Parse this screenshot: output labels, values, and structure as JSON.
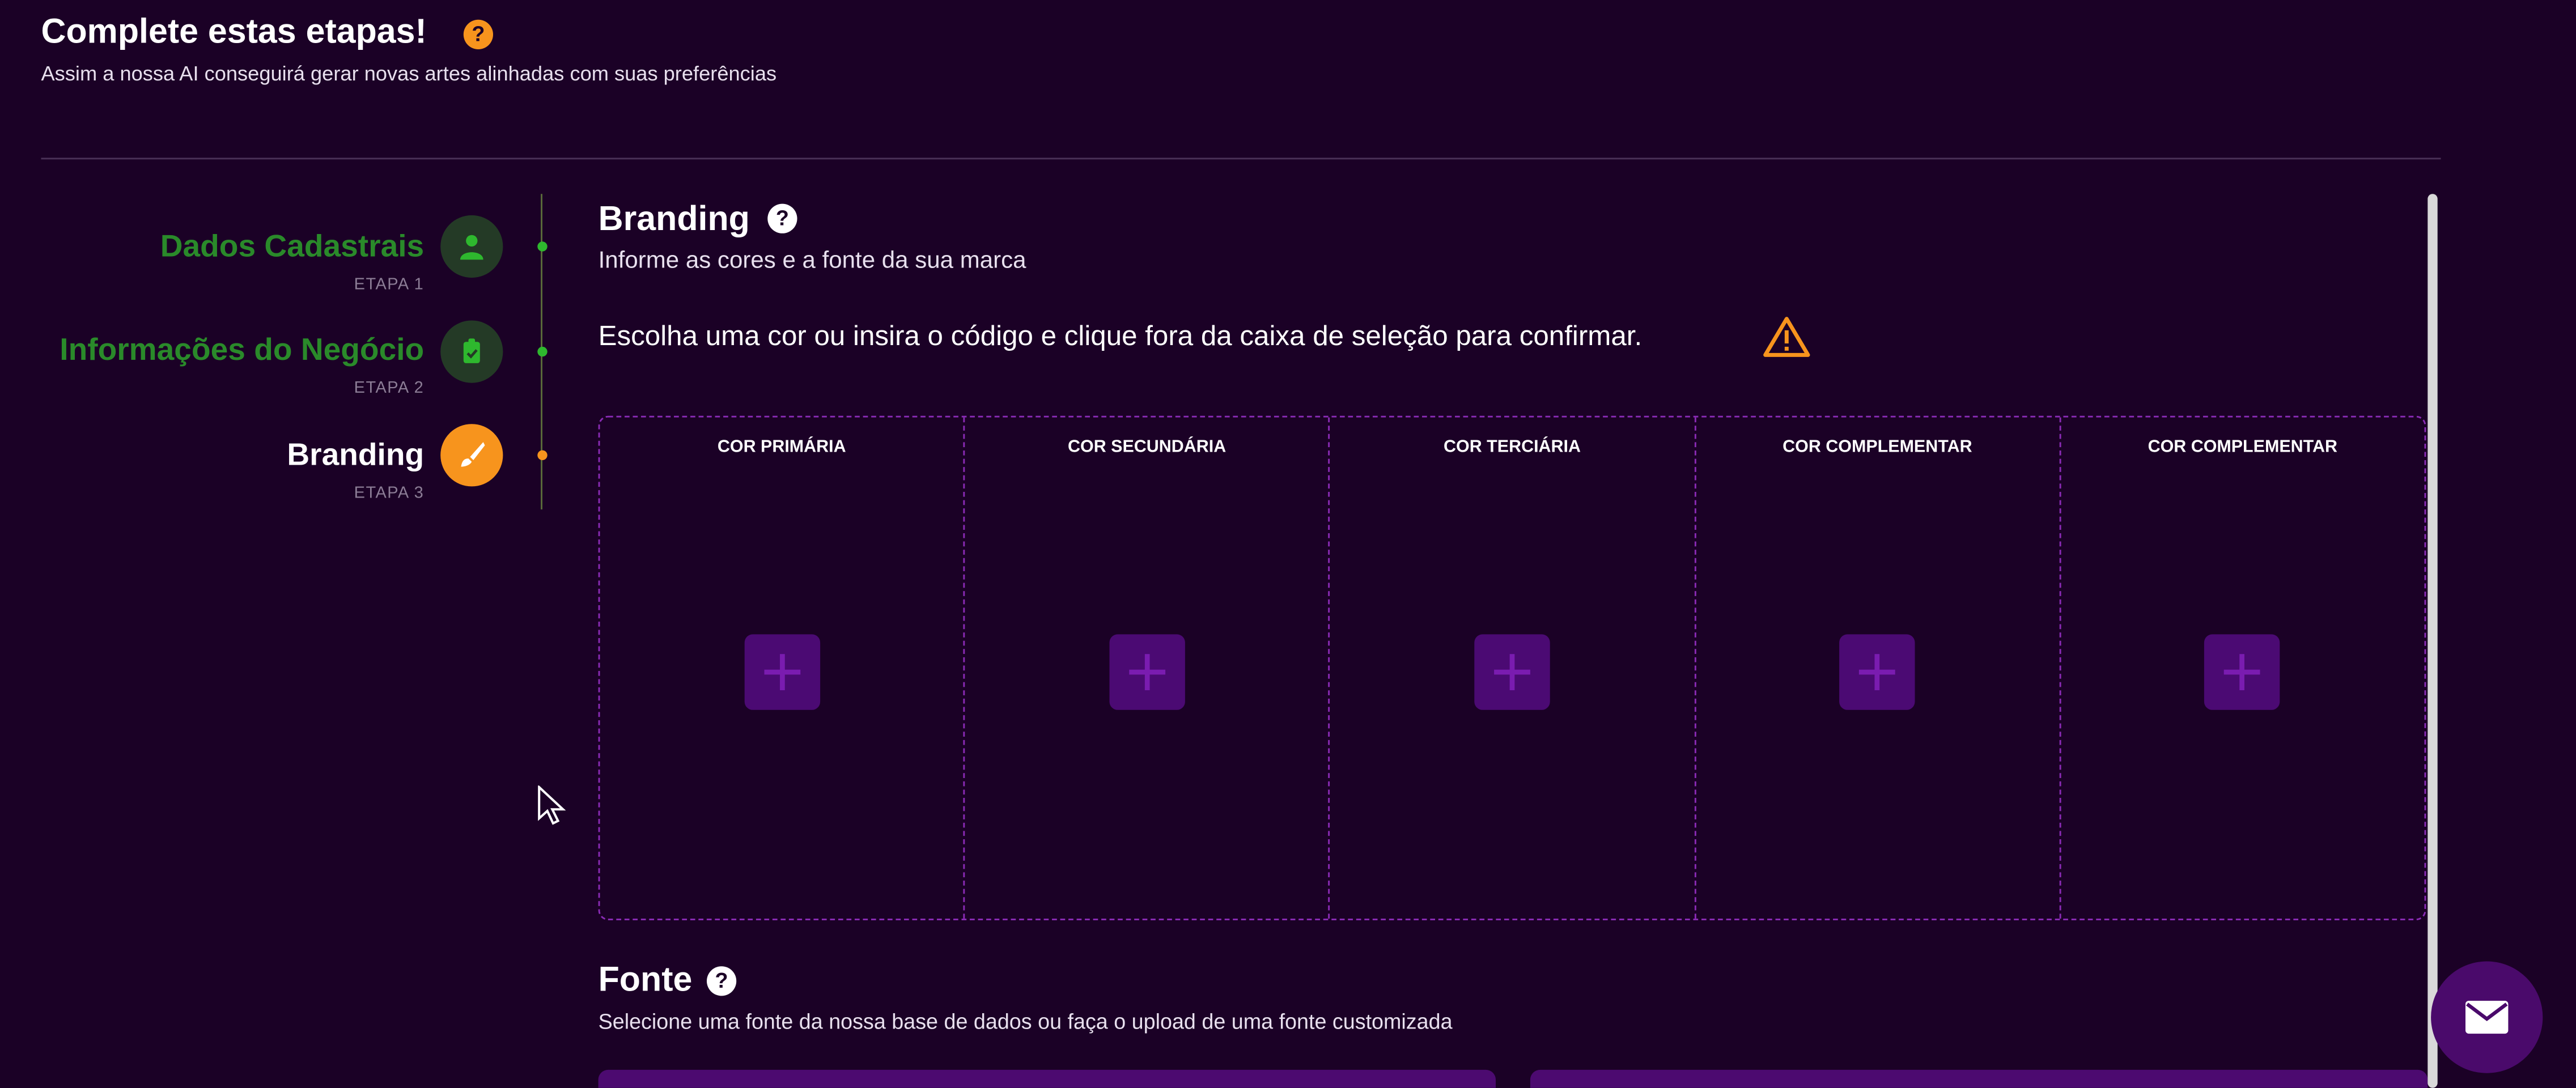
{
  "header": {
    "title": "Complete estas etapas!",
    "help_icon": "question-icon",
    "subtitle": "Assim a nossa AI conseguirá gerar novas artes alinhadas com suas preferências"
  },
  "steps": [
    {
      "title": "Dados Cadastrais",
      "label": "ETAPA 1",
      "icon": "user-icon",
      "status": "completed"
    },
    {
      "title": "Informações do Negócio",
      "label": "ETAPA 2",
      "icon": "clipboard-icon",
      "status": "completed"
    },
    {
      "title": "Branding",
      "label": "ETAPA 3",
      "icon": "brush-icon",
      "status": "active"
    }
  ],
  "branding": {
    "title": "Branding",
    "subtitle": "Informe as cores e a fonte da sua marca",
    "instruction": "Escolha uma cor ou insira o código e clique fora da caixa de seleção para confirmar.",
    "colors": [
      {
        "label": "COR PRIMÁRIA"
      },
      {
        "label": "COR SECUNDÁRIA"
      },
      {
        "label": "COR TERCIÁRIA"
      },
      {
        "label": "COR COMPLEMENTAR"
      },
      {
        "label": "COR COMPLEMENTAR"
      }
    ]
  },
  "font": {
    "title": "Fonte",
    "subtitle": "Selecione uma fonte da nossa base de dados ou faça o upload de uma fonte customizada"
  },
  "theme": {
    "background": "#1b0126",
    "accent_orange": "#f7941d",
    "completed_green": "#2a8a2a",
    "dashed_border": "#8a2bb5",
    "add_button": "#4b0a73"
  }
}
